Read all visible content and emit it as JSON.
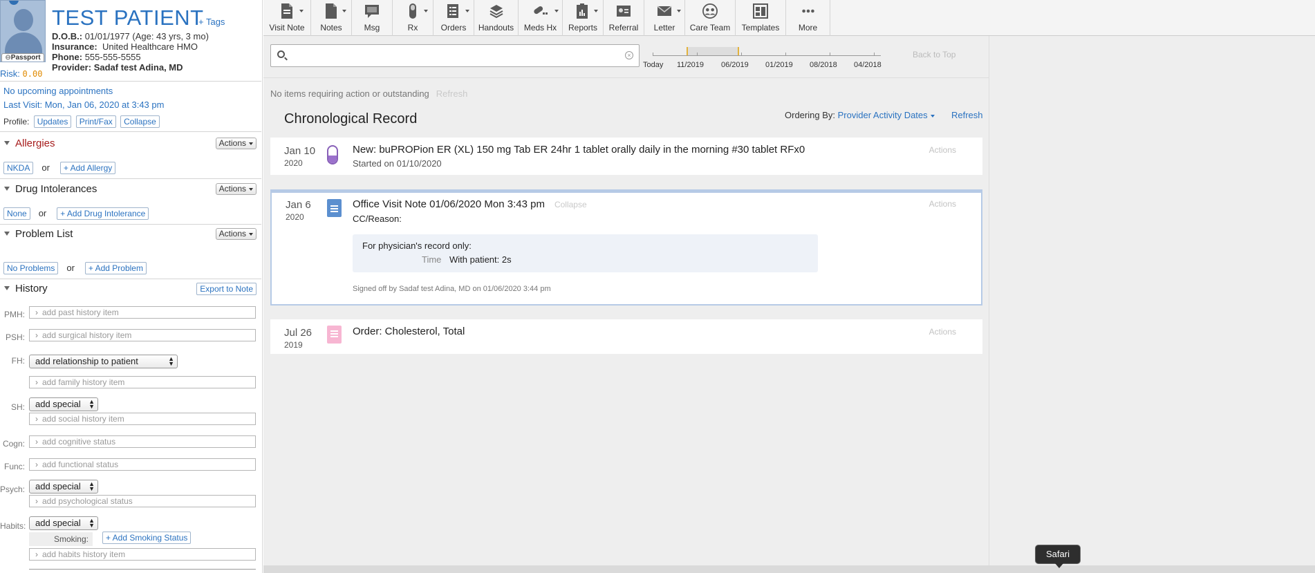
{
  "patient": {
    "name": "TEST PATIENT",
    "tags_link": "+ Tags",
    "passport": "Passport",
    "dob_label": "D.O.B.:",
    "dob_value": "01/01/1977 (Age: 43 yrs, 3 mo)",
    "insurance_label": "Insurance:",
    "insurance_value": "United Healthcare HMO",
    "phone_label": "Phone:",
    "phone_value": "555-555-5555",
    "provider_label": "Provider:",
    "provider_value": "Sadaf test Adina, MD",
    "risk_label": "Risk:",
    "risk_value": "0.00",
    "upcoming": "No upcoming appointments",
    "last_visit": "Last Visit: Mon, Jan 06, 2020 at 3:43 pm",
    "profile_label": "Profile:",
    "profile_buttons": [
      "Updates",
      "Print/Fax",
      "Collapse"
    ]
  },
  "sections": {
    "allergies": {
      "title": "Allergies",
      "actions": "Actions",
      "btn1": "NKDA",
      "or": "or",
      "btn2": "+ Add Allergy"
    },
    "drug_intolerances": {
      "title": "Drug Intolerances",
      "actions": "Actions",
      "btn1": "None",
      "or": "or",
      "btn2": "+ Add Drug Intolerance"
    },
    "problem_list": {
      "title": "Problem List",
      "actions": "Actions",
      "btn1": "No Problems",
      "or": "or",
      "btn2": "+ Add Problem"
    },
    "history": {
      "title": "History",
      "export": "Export to Note"
    }
  },
  "history_fields": {
    "pmh_label": "PMH:",
    "pmh_placeholder": "add past history item",
    "psh_label": "PSH:",
    "psh_placeholder": "add surgical history item",
    "fh_label": "FH:",
    "fh_select": "add relationship to patient",
    "fh_placeholder": "add family history item",
    "sh_label": "SH:",
    "sh_select": "add special",
    "sh_placeholder": "add social history item",
    "cogn_label": "Cogn:",
    "cogn_placeholder": "add cognitive status",
    "func_label": "Func:",
    "func_placeholder": "add functional status",
    "psych_label": "Psych:",
    "psych_select": "add special",
    "psych_placeholder": "add psychological status",
    "habits_label": "Habits:",
    "habits_select": "add special",
    "smoking_label": "Smoking:",
    "smoking_btn": "+ Add Smoking Status",
    "habits_placeholder": "add habits history item"
  },
  "toolbar": [
    "Visit Note",
    "Notes",
    "Msg",
    "Rx",
    "Orders",
    "Handouts",
    "Meds Hx",
    "Reports",
    "Referral",
    "Letter",
    "Care Team",
    "Templates",
    "More"
  ],
  "timeline": {
    "labels": [
      "Today",
      "11/2019",
      "06/2019",
      "01/2019",
      "08/2018",
      "04/2018"
    ],
    "back_to_top": "Back to Top"
  },
  "status": {
    "no_items": "No items requiring action or outstanding",
    "refresh": "Refresh"
  },
  "chrono": {
    "title": "Chronological Record",
    "ordering_label": "Ordering By:",
    "ordering_value": "Provider Activity Dates",
    "refresh": "Refresh"
  },
  "entries": [
    {
      "date": "Jan 10",
      "year": "2020",
      "title": "New: buPROPion ER (XL) 150 mg Tab ER 24hr 1 tablet orally daily in the morning #30 tablet RFx0",
      "sub": "Started on 01/10/2020",
      "actions": "Actions"
    },
    {
      "date": "Jan 6",
      "year": "2020",
      "title": "Office Visit Note 01/06/2020 Mon 3:43 pm",
      "collapse": "Collapse",
      "sub": "CC/Reason:",
      "box_line1": "For physician's record only:",
      "box_time_label": "Time",
      "box_time_value": "With patient: 2s",
      "signed": "Signed off by Sadaf test Adina, MD on 01/06/2020 3:44 pm",
      "actions": "Actions"
    },
    {
      "date": "Jul 26",
      "year": "2019",
      "title": "Order: Cholesterol, Total",
      "actions": "Actions"
    }
  ],
  "tooltip": "Safari"
}
